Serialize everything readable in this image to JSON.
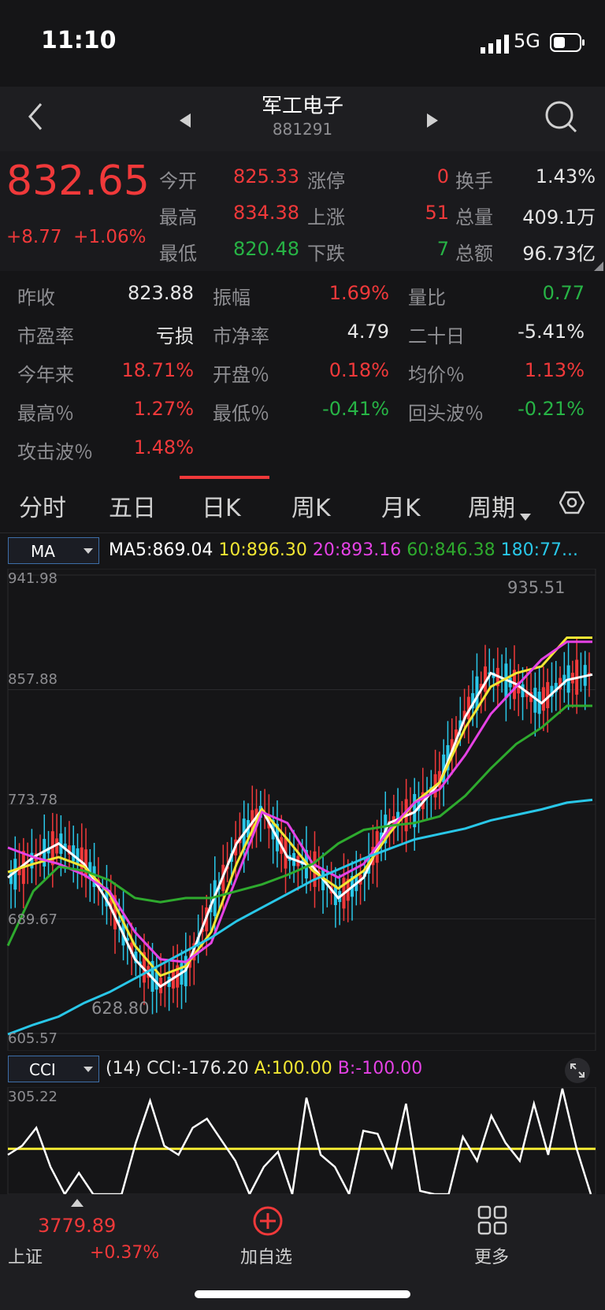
{
  "status": {
    "time": "11:10",
    "network": "5G"
  },
  "header": {
    "title": "军工电子",
    "code": "881291"
  },
  "quote": {
    "price": "832.65",
    "change": "+8.77",
    "change_pct": "+1.06%",
    "rows": [
      {
        "l1": "今开",
        "v1": "825.33",
        "l2": "涨停",
        "v2": "0",
        "l3": "换手",
        "v3": "1.43%"
      },
      {
        "l1": "最高",
        "v1": "834.38",
        "l2": "上涨",
        "v2": "51",
        "l3": "总量",
        "v3": "409.1万"
      },
      {
        "l1": "最低",
        "v1": "820.48",
        "l2": "下跌",
        "v2": "7",
        "l3": "总额",
        "v3": "96.73亿"
      }
    ]
  },
  "stats": [
    {
      "label": "昨收",
      "value": "823.88"
    },
    {
      "label": "振幅",
      "value": "1.69%"
    },
    {
      "label": "量比",
      "value": "0.77"
    },
    {
      "label": "市盈率",
      "value": "亏损"
    },
    {
      "label": "市净率",
      "value": "4.79"
    },
    {
      "label": "二十日",
      "value": "-5.41%"
    },
    {
      "label": "今年来",
      "value": "18.71%"
    },
    {
      "label": "开盘％",
      "value": "0.18%"
    },
    {
      "label": "均价％",
      "value": "1.13%"
    },
    {
      "label": "最高％",
      "value": "1.27%"
    },
    {
      "label": "最低％",
      "value": "-0.41%"
    },
    {
      "label": "回头波％",
      "value": "-0.21%"
    },
    {
      "label": "攻击波％",
      "value": "1.48%"
    }
  ],
  "tabs": [
    "分时",
    "五日",
    "日K",
    "周K",
    "月K",
    "周期"
  ],
  "ma": {
    "selector": "MA",
    "ma5_label": "MA5:",
    "ma5": "869.04",
    "ma10_label": "10:",
    "ma10": "896.30",
    "ma20_label": "20:",
    "ma20": "893.16",
    "ma60_label": "60:",
    "ma60": "846.38",
    "ma180_label": "180:",
    "ma180": "77..."
  },
  "chart_data": {
    "type": "line",
    "y_ticks": [
      "941.98",
      "857.88",
      "773.78",
      "689.67",
      "605.57"
    ],
    "ylim": [
      605.57,
      941.98
    ],
    "high_label": "935.51",
    "low_label": "628.80",
    "series": [
      {
        "name": "MA5",
        "values": [
          720,
          735,
          745,
          730,
          700,
          660,
          640,
          652,
          700,
          745,
          770,
          735,
          728,
          705,
          720,
          760,
          768,
          790,
          838,
          870,
          862,
          848,
          865,
          869
        ]
      },
      {
        "name": "MA10",
        "values": [
          724,
          730,
          735,
          728,
          708,
          670,
          648,
          655,
          680,
          730,
          770,
          748,
          725,
          712,
          725,
          752,
          775,
          790,
          830,
          860,
          870,
          875,
          896,
          896
        ]
      },
      {
        "name": "MA20",
        "values": [
          742,
          735,
          730,
          722,
          710,
          680,
          660,
          658,
          672,
          720,
          768,
          760,
          730,
          720,
          730,
          755,
          775,
          785,
          810,
          840,
          860,
          880,
          893,
          893
        ]
      },
      {
        "name": "MA60",
        "values": [
          670,
          710,
          728,
          725,
          718,
          705,
          702,
          705,
          705,
          710,
          715,
          722,
          730,
          745,
          755,
          758,
          760,
          765,
          780,
          800,
          818,
          830,
          846,
          846
        ]
      },
      {
        "name": "MA180",
        "values": [
          605,
          612,
          618,
          628,
          636,
          646,
          656,
          666,
          676,
          688,
          698,
          708,
          718,
          726,
          734,
          741,
          748,
          752,
          756,
          762,
          766,
          770,
          775,
          777
        ]
      }
    ],
    "colors": {
      "MA5": "#ffffff",
      "MA10": "#f2e633",
      "MA20": "#e542e5",
      "MA60": "#2eaa2e",
      "MA180": "#29c7e8"
    }
  },
  "cci": {
    "selector": "CCI",
    "period": "(14)",
    "cci_label": "CCI:",
    "cci": "-176.20",
    "a_label": "A:",
    "a": "100.00",
    "b_label": "B:",
    "b": "-100.00",
    "top": "305.22",
    "values": [
      80,
      110,
      170,
      40,
      -90,
      20,
      -120,
      -140,
      -60,
      120,
      260,
      110,
      80,
      170,
      200,
      130,
      60,
      -100,
      40,
      90,
      -80,
      270,
      80,
      40,
      -110,
      160,
      150,
      40,
      250,
      -40,
      -140,
      -90,
      140,
      60,
      210,
      120,
      60,
      250,
      80,
      300,
      100,
      -176
    ]
  },
  "bottom": {
    "index_value": "3779.89",
    "index_name": "上证",
    "index_change": "+0.37%",
    "add_label": "加自选",
    "more_label": "更多"
  }
}
